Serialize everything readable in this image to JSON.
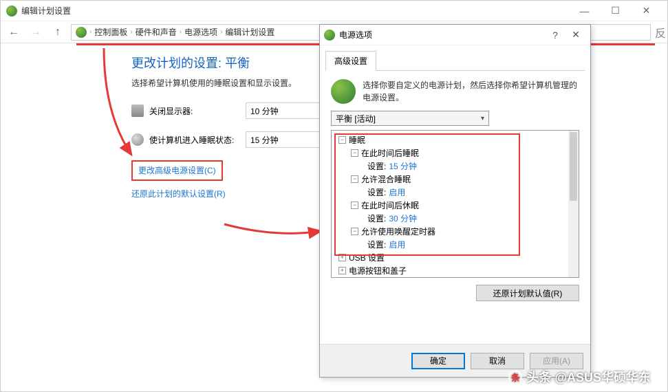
{
  "window": {
    "title": "编辑计划设置"
  },
  "breadcrumb": {
    "items": [
      "控制面板",
      "硬件和声音",
      "电源选项",
      "编辑计划设置"
    ],
    "overflow": "反"
  },
  "page": {
    "title": "更改计划的设置: 平衡",
    "subtitle": "选择希望计算机使用的睡眠设置和显示设置。",
    "rows": [
      {
        "label": "关闭显示器:",
        "value": "10 分钟"
      },
      {
        "label": "使计算机进入睡眠状态:",
        "value": "15 分钟"
      }
    ],
    "links": {
      "advanced": "更改高级电源设置(C)",
      "restore": "还原此计划的默认设置(R)"
    }
  },
  "dialog": {
    "title": "电源选项",
    "tab": "高级设置",
    "instruction": "选择你要自定义的电源计划，然后选择你希望计算机管理的电源设置。",
    "combo": "平衡 [活动]",
    "tree": {
      "root": "睡眠",
      "n1": {
        "label": "在此时间后睡眠",
        "setting_label": "设置:",
        "value": "15 分钟"
      },
      "n2": {
        "label": "允许混合睡眠",
        "setting_label": "设置:",
        "value": "启用"
      },
      "n3": {
        "label": "在此时间后休眠",
        "setting_label": "设置:",
        "value": "30 分钟"
      },
      "n4": {
        "label": "允许使用唤醒定时器",
        "setting_label": "设置:",
        "value": "启用"
      },
      "extra1": "USB 设置",
      "extra2": "电源按钮和盖子"
    },
    "restore_button": "还原计划默认值(R)",
    "buttons": {
      "ok": "确定",
      "cancel": "取消",
      "apply": "应用(A)"
    }
  },
  "watermark": "头条 @ASUS华硕华东"
}
